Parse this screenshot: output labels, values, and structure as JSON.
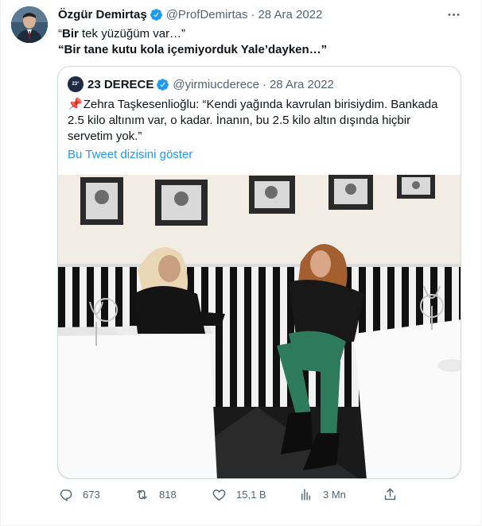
{
  "tweet": {
    "author_name": "Özgür Demirtaş",
    "handle": "@ProfDemirtas",
    "separator": "·",
    "date": "28 Ara 2022",
    "line1_bold": "Bir",
    "line1_rest": " tek yüzüğüm var…”",
    "line1_open": "“",
    "line2": "“Bir tane kutu kola içemiyorduk Yale’dayken…”"
  },
  "quote": {
    "author_name": "23 DERECE",
    "avatar_text": "23°",
    "handle": "@yirmiucderece",
    "separator": "·",
    "date": "28 Ara 2022",
    "pin_icon": "📌",
    "text": "Zehra Taşkesenlioğlu: “Kendi yağında kavrulan birisiydim. Bankada 2.5 kilo altınım var, o kadar. İnanın, bu 2.5 kilo altın dışında hiçbir servetim yok.”",
    "thread_link": "Bu Tweet dizisini göster"
  },
  "actions": {
    "replies": "673",
    "retweets": "818",
    "likes": "15,1 B",
    "views": "3 Mn"
  },
  "colors": {
    "verified": "#1d9bf0",
    "link": "#1d9bf0",
    "muted": "#536471"
  }
}
